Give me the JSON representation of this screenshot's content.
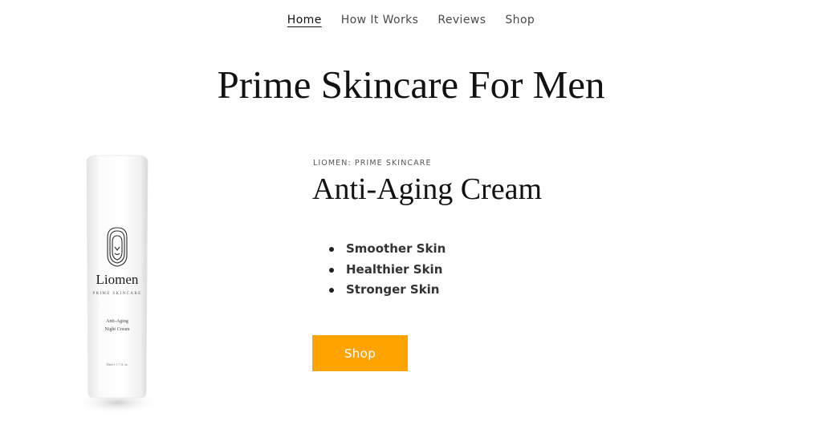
{
  "nav": {
    "items": [
      {
        "label": "Home",
        "active": true
      },
      {
        "label": "How It Works",
        "active": false
      },
      {
        "label": "Reviews",
        "active": false
      },
      {
        "label": "Shop",
        "active": false
      }
    ]
  },
  "hero": {
    "title": "Prime Skincare For Men"
  },
  "product": {
    "eyebrow": "LIOMEN: PRIME SKINCARE",
    "title": "Anti-Aging Cream",
    "benefits": [
      "Smoother Skin",
      "Healthier Skin",
      "Stronger Skin"
    ],
    "shop_label": "Shop",
    "image": {
      "brand": "Liomen",
      "tagline": "PRIME SKINCARE",
      "line1": "Anti-Aging",
      "line2": "Night Cream",
      "volume": "50ml e 1.7 fl. oz.",
      "icon": "lion-logo-icon"
    }
  },
  "colors": {
    "accent": "#ffa300",
    "text": "#121212",
    "nav_text": "#4a4a4a"
  }
}
